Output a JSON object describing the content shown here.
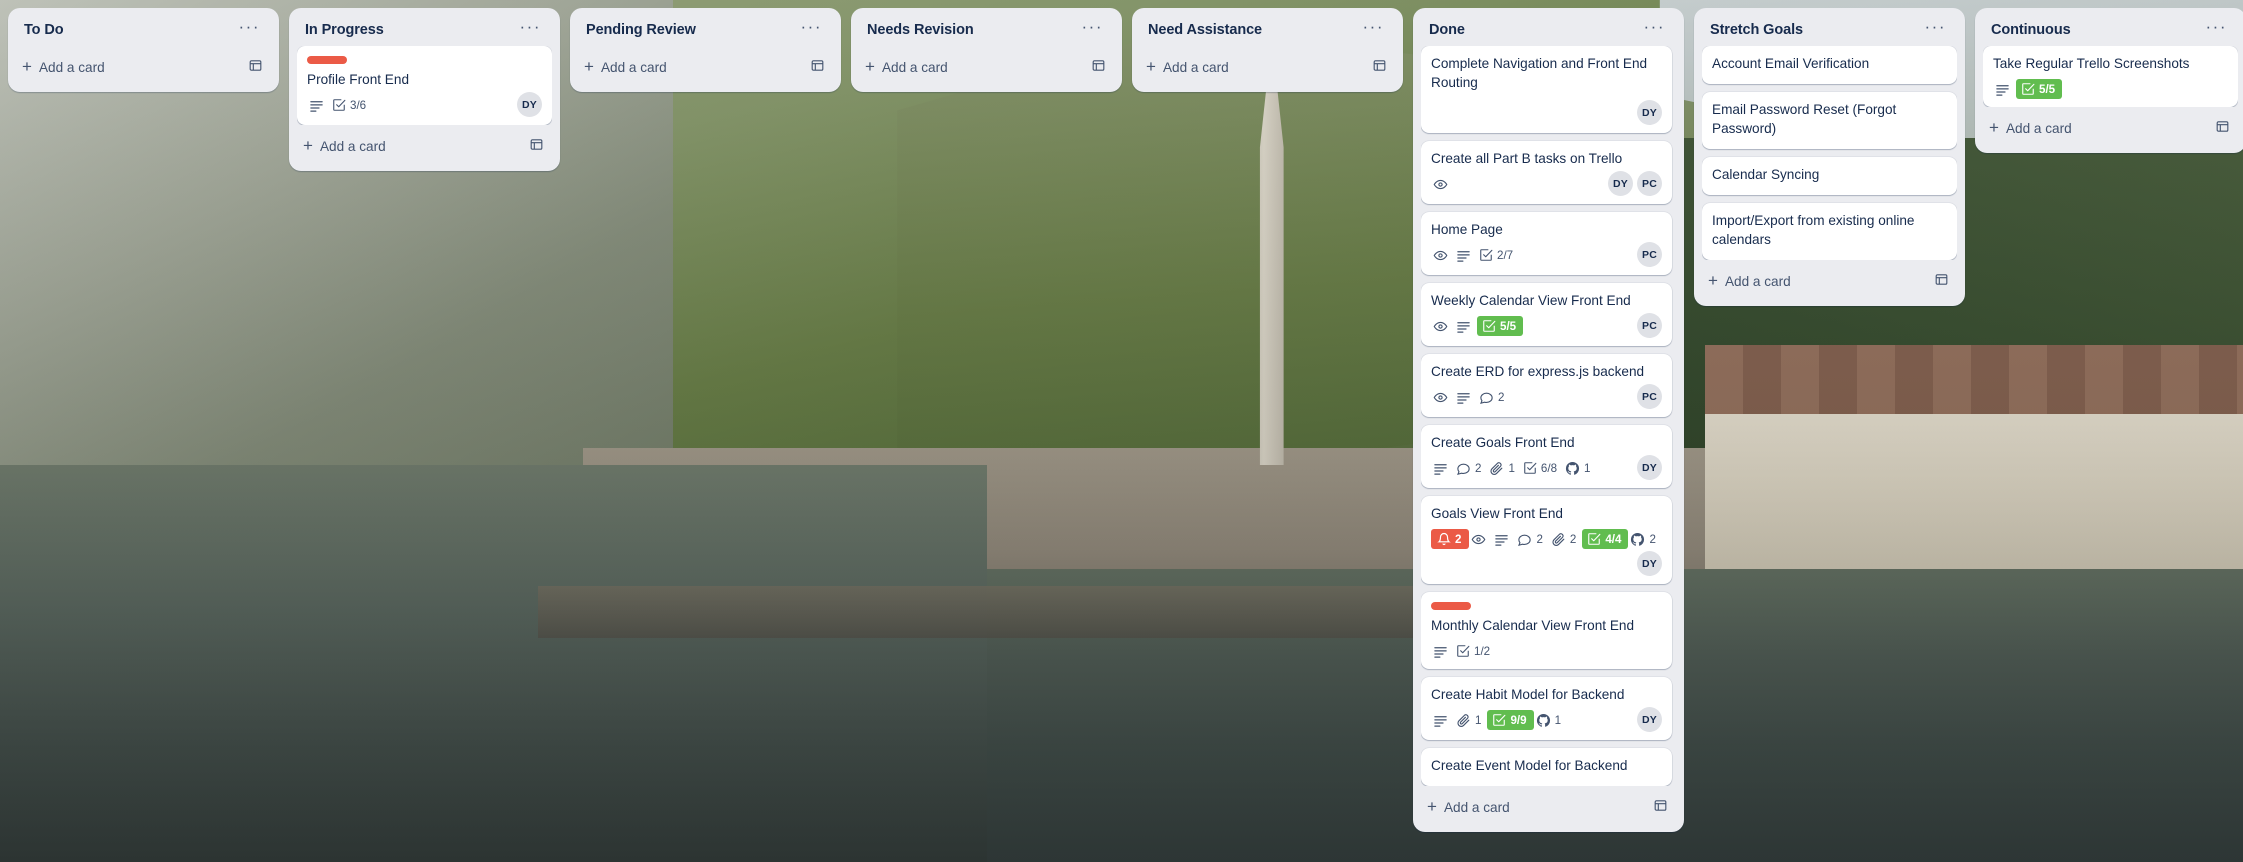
{
  "theme": {
    "list_bg": "#ebecf0",
    "card_bg": "#ffffff",
    "text": "#172b4d",
    "subtle_text": "#44546f",
    "label_red": "#eb5a46",
    "badge_green": "#61bd4f",
    "badge_red": "#eb5a46",
    "avatar_bg": "#dfe1e6"
  },
  "add_card_label": "Add a card",
  "list_menu_glyph": "···",
  "lists": [
    {
      "title": "To Do",
      "menu": "list-actions-menu",
      "scroll": false,
      "cards": []
    },
    {
      "title": "In Progress",
      "menu": "list-actions-menu",
      "scroll": false,
      "cards": [
        {
          "title": "Profile Front End",
          "labels": [
            "#eb5a46"
          ],
          "badges": [
            {
              "icon": "description-icon",
              "text": ""
            },
            {
              "icon": "checklist-icon",
              "text": "3/6"
            }
          ],
          "members": [
            "DY"
          ],
          "members_own_row": false
        }
      ]
    },
    {
      "title": "Pending Review",
      "menu": "list-actions-menu",
      "scroll": false,
      "cards": []
    },
    {
      "title": "Needs Revision",
      "menu": "list-actions-menu",
      "scroll": false,
      "cards": []
    },
    {
      "title": "Need Assistance",
      "menu": "list-actions-menu",
      "scroll": false,
      "cards": []
    },
    {
      "title": "Done",
      "menu": "list-actions-menu",
      "scroll": true,
      "cards": [
        {
          "title": "Complete Navigation and Front End Routing",
          "labels": [],
          "badges": [],
          "members": [
            "DY"
          ],
          "members_own_row": true
        },
        {
          "title": "Create all Part B tasks on Trello",
          "labels": [],
          "badges": [
            {
              "icon": "watch-icon",
              "text": ""
            }
          ],
          "members": [
            "DY",
            "PC"
          ],
          "members_own_row": false
        },
        {
          "title": "Home Page",
          "labels": [],
          "badges": [
            {
              "icon": "watch-icon",
              "text": ""
            },
            {
              "icon": "description-icon",
              "text": ""
            },
            {
              "icon": "checklist-icon",
              "text": "2/7"
            }
          ],
          "members": [
            "PC"
          ],
          "members_own_row": false
        },
        {
          "title": "Weekly Calendar View Front End",
          "labels": [],
          "badges": [
            {
              "icon": "watch-icon",
              "text": ""
            },
            {
              "icon": "description-icon",
              "text": ""
            },
            {
              "icon": "checklist-icon",
              "text": "5/5",
              "style": "green"
            }
          ],
          "members": [
            "PC"
          ],
          "members_own_row": false
        },
        {
          "title": "Create ERD for express.js backend",
          "labels": [],
          "badges": [
            {
              "icon": "watch-icon",
              "text": ""
            },
            {
              "icon": "description-icon",
              "text": ""
            },
            {
              "icon": "comment-icon",
              "text": "2"
            }
          ],
          "members": [
            "PC"
          ],
          "members_own_row": false
        },
        {
          "title": "Create Goals Front End",
          "labels": [],
          "badges": [
            {
              "icon": "description-icon",
              "text": ""
            },
            {
              "icon": "comment-icon",
              "text": "2"
            },
            {
              "icon": "attachment-icon",
              "text": "1"
            },
            {
              "icon": "checklist-icon",
              "text": "6/8"
            },
            {
              "icon": "github-icon",
              "text": "1"
            }
          ],
          "members": [
            "DY"
          ],
          "members_own_row": false
        },
        {
          "title": "Goals View Front End",
          "labels": [],
          "badges": [
            {
              "icon": "due-date-icon",
              "text": "2",
              "style": "red"
            },
            {
              "icon": "watch-icon",
              "text": ""
            },
            {
              "icon": "description-icon",
              "text": ""
            },
            {
              "icon": "comment-icon",
              "text": "2"
            },
            {
              "icon": "attachment-icon",
              "text": "2"
            },
            {
              "icon": "checklist-icon",
              "text": "4/4",
              "style": "green"
            },
            {
              "icon": "github-icon",
              "text": "2"
            }
          ],
          "members": [
            "DY"
          ],
          "members_own_row": true
        },
        {
          "title": "Monthly Calendar View Front End",
          "labels": [
            "#eb5a46"
          ],
          "badges": [
            {
              "icon": "description-icon",
              "text": ""
            },
            {
              "icon": "checklist-icon",
              "text": "1/2"
            }
          ],
          "members": [],
          "members_own_row": false
        },
        {
          "title": "Create Habit Model for Backend",
          "labels": [],
          "badges": [
            {
              "icon": "description-icon",
              "text": ""
            },
            {
              "icon": "attachment-icon",
              "text": "1"
            },
            {
              "icon": "checklist-icon",
              "text": "9/9",
              "style": "green"
            },
            {
              "icon": "github-icon",
              "text": "1"
            }
          ],
          "members": [
            "DY"
          ],
          "members_own_row": false
        },
        {
          "title": "Create Event Model for Backend",
          "labels": [],
          "badges": [],
          "members": [],
          "members_own_row": false
        }
      ]
    },
    {
      "title": "Stretch Goals",
      "menu": "list-actions-menu",
      "scroll": false,
      "cards": [
        {
          "title": "Account Email Verification",
          "labels": [],
          "badges": [],
          "members": [],
          "members_own_row": false
        },
        {
          "title": "Email Password Reset (Forgot Password)",
          "labels": [],
          "badges": [],
          "members": [],
          "members_own_row": false
        },
        {
          "title": "Calendar Syncing",
          "labels": [],
          "badges": [],
          "members": [],
          "members_own_row": false
        },
        {
          "title": "Import/Export from existing online calendars",
          "labels": [],
          "badges": [],
          "members": [],
          "members_own_row": false
        }
      ]
    },
    {
      "title": "Continuous",
      "menu": "list-actions-menu",
      "scroll": false,
      "cards": [
        {
          "title": "Take Regular Trello Screenshots",
          "labels": [],
          "badges": [
            {
              "icon": "description-icon",
              "text": ""
            },
            {
              "icon": "checklist-icon",
              "text": "5/5",
              "style": "green"
            }
          ],
          "members": [],
          "members_own_row": false
        }
      ]
    }
  ]
}
